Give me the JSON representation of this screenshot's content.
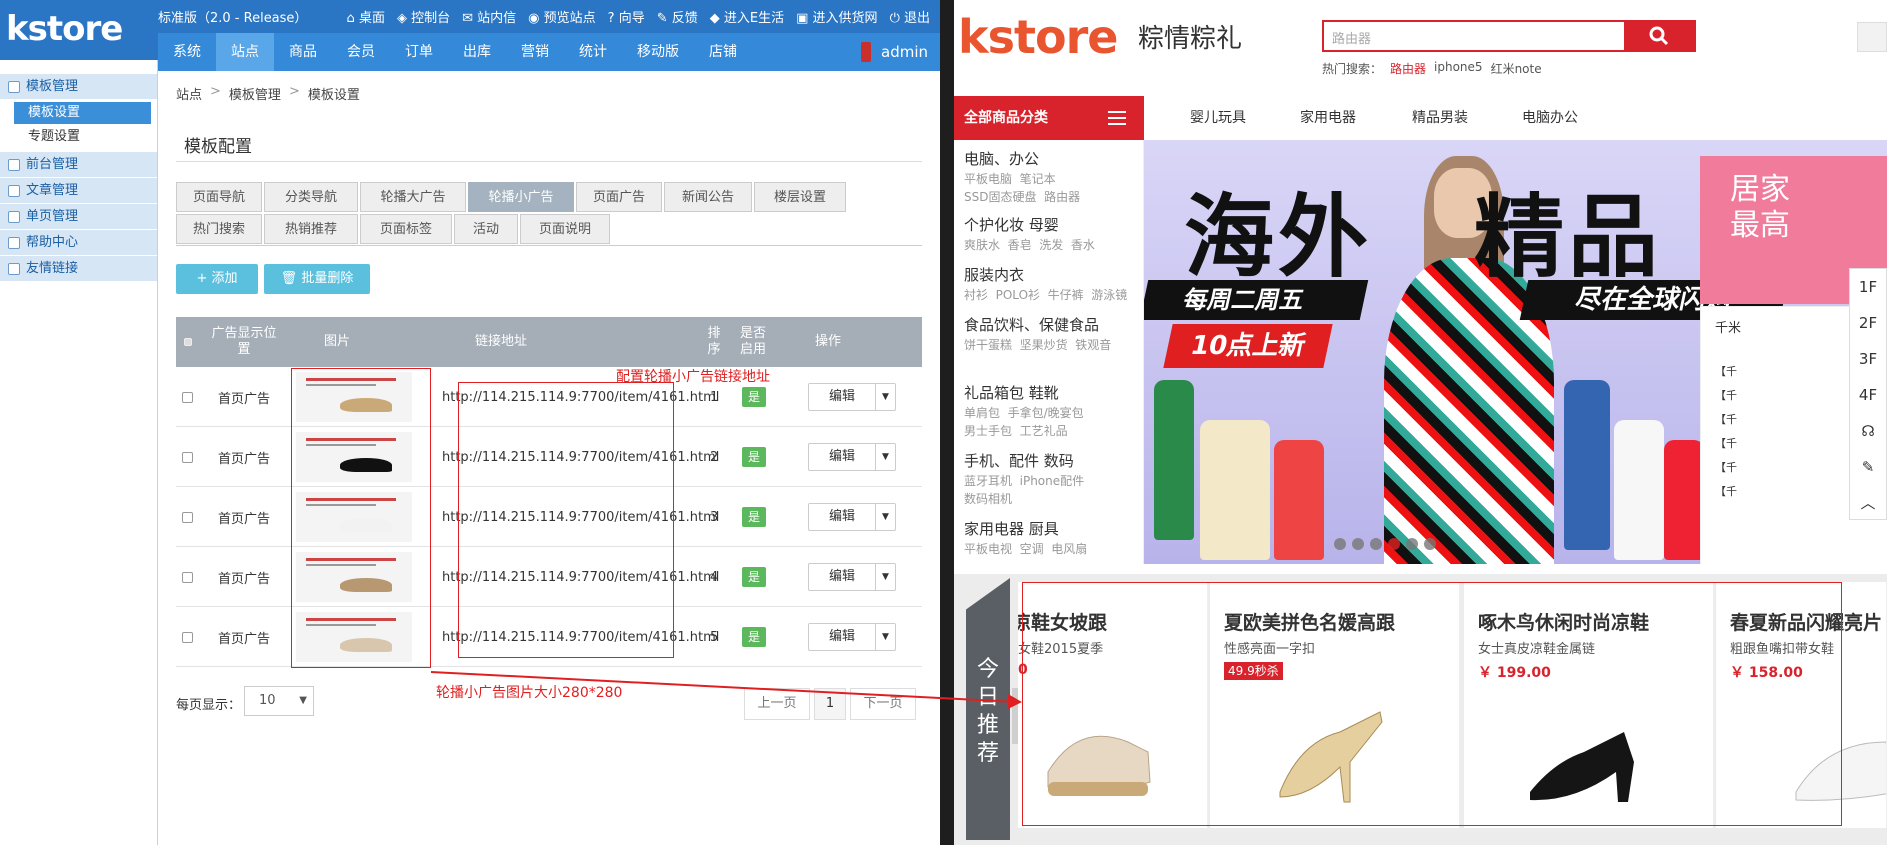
{
  "admin": {
    "logo": "kstore",
    "edition": "标准版（2.0 - Release）",
    "toplinks": [
      "桌面",
      "控制台",
      "站内信",
      "预览站点",
      "向导",
      "反馈",
      "进入E生活",
      "进入供货网",
      "退出"
    ],
    "mainnav": [
      "系统",
      "站点",
      "商品",
      "会员",
      "订单",
      "出库",
      "营销",
      "统计",
      "移动版",
      "店铺"
    ],
    "active_nav": "站点",
    "user": "admin",
    "sidebar": {
      "groups": [
        {
          "label": "模板管理",
          "subs": [
            "模板设置",
            "专题设置"
          ]
        },
        {
          "label": "前台管理",
          "subs": []
        },
        {
          "label": "文章管理",
          "subs": []
        },
        {
          "label": "单页管理",
          "subs": []
        },
        {
          "label": "帮助中心",
          "subs": []
        },
        {
          "label": "友情链接",
          "subs": []
        }
      ],
      "active_sub": "模板设置"
    },
    "breadcrumb": [
      "站点",
      "模板管理",
      "模板设置"
    ],
    "breadcrumb_sep": ">",
    "panel_title": "模板配置",
    "tabs_row1": [
      "页面导航",
      "分类导航",
      "轮播大广告",
      "轮播小广告",
      "页面广告",
      "新闻公告",
      "楼层设置"
    ],
    "tabs_row2": [
      "热门搜索",
      "热销推荐",
      "页面标签",
      "活动",
      "页面说明"
    ],
    "active_tab": "轮播小广告",
    "buttons": {
      "add": "+ 添加",
      "batch_delete": "批量删除"
    },
    "table": {
      "headers": [
        "广告显示位置",
        "图片",
        "链接地址",
        "排序",
        "是否启用",
        "操作"
      ],
      "rows": [
        {
          "position": "首页广告",
          "link": "http://114.215.114.9:7700/item/4161.html",
          "sort": "1",
          "enabled": "是"
        },
        {
          "position": "首页广告",
          "link": "http://114.215.114.9:7700/item/4161.html",
          "sort": "2",
          "enabled": "是"
        },
        {
          "position": "首页广告",
          "link": "http://114.215.114.9:7700/item/4161.html",
          "sort": "3",
          "enabled": "是"
        },
        {
          "position": "首页广告",
          "link": "http://114.215.114.9:7700/item/4161.html",
          "sort": "4",
          "enabled": "是"
        },
        {
          "position": "首页广告",
          "link": "http://114.215.114.9:7700/item/4161.html",
          "sort": "5",
          "enabled": "是"
        }
      ],
      "edit_label": "编辑"
    },
    "annotations": {
      "link_note": "配置轮播小广告链接地址",
      "size_note": "轮播小广告图片大小280*280"
    },
    "pager": {
      "label": "每页显示：",
      "page_size": "10",
      "prev": "上一页",
      "current": "1",
      "next": "下一页"
    }
  },
  "store": {
    "logo": "kstore",
    "brand": "粽情粽礼",
    "search_placeholder": "路由器",
    "hot_label": "热门搜索：",
    "hot_terms": [
      "路由器",
      "iphone5",
      "红米note"
    ],
    "all_categories": "全部商品分类",
    "nav": [
      "婴儿玩具",
      "家用电器",
      "精品男装",
      "电脑办公"
    ],
    "categories": [
      {
        "title": "电脑、办公",
        "subs": "平板电脑  笔记本\nSSD固态硬盘  路由器"
      },
      {
        "title": "个护化妆  母婴",
        "subs": "爽肤水  香皂  洗发  香水"
      },
      {
        "title": "服装内衣",
        "subs": "衬衫  POLO衫  牛仔裤  游泳镜"
      },
      {
        "title": "食品饮料、保健食品",
        "subs": "饼干蛋糕  坚果炒货  铁观音"
      },
      {
        "title": "礼品箱包  鞋靴",
        "subs": "单肩包  手拿包/晚宴包\n男士手包  工艺礼品"
      },
      {
        "title": "手机、配件  数码",
        "subs": "蓝牙耳机  iPhone配件\n数码相机"
      },
      {
        "title": "家用电器  厨具",
        "subs": "平板电视  空调  电风扇"
      }
    ],
    "banner": {
      "t1": "海外",
      "t2": "精品",
      "s1": "每周二周五",
      "s2": "10点上新",
      "s3": "尽在全球闪购"
    },
    "side_banner": "居家\n最高",
    "news_head": "千米",
    "news_items": [
      "【千",
      "【千",
      "【千",
      "【千",
      "【千",
      "【千"
    ],
    "floors": [
      "1F",
      "2F",
      "3F",
      "4F"
    ],
    "recommend_label": "今日推荐",
    "products": [
      {
        "title": "凉鞋女坡跟",
        "sub": "女鞋2015夏季",
        "price": "0"
      },
      {
        "title": "夏欧美拼色名媛高跟",
        "sub": "性感亮面一字扣",
        "badge": "49.9秒杀"
      },
      {
        "title": "啄木鸟休闲时尚凉鞋",
        "sub": "女士真皮凉鞋金属链",
        "price": "￥ 199.00"
      },
      {
        "title": "春夏新品闪耀亮片",
        "sub": "粗跟鱼嘴扣带女鞋",
        "price": "￥ 158.00"
      }
    ]
  }
}
